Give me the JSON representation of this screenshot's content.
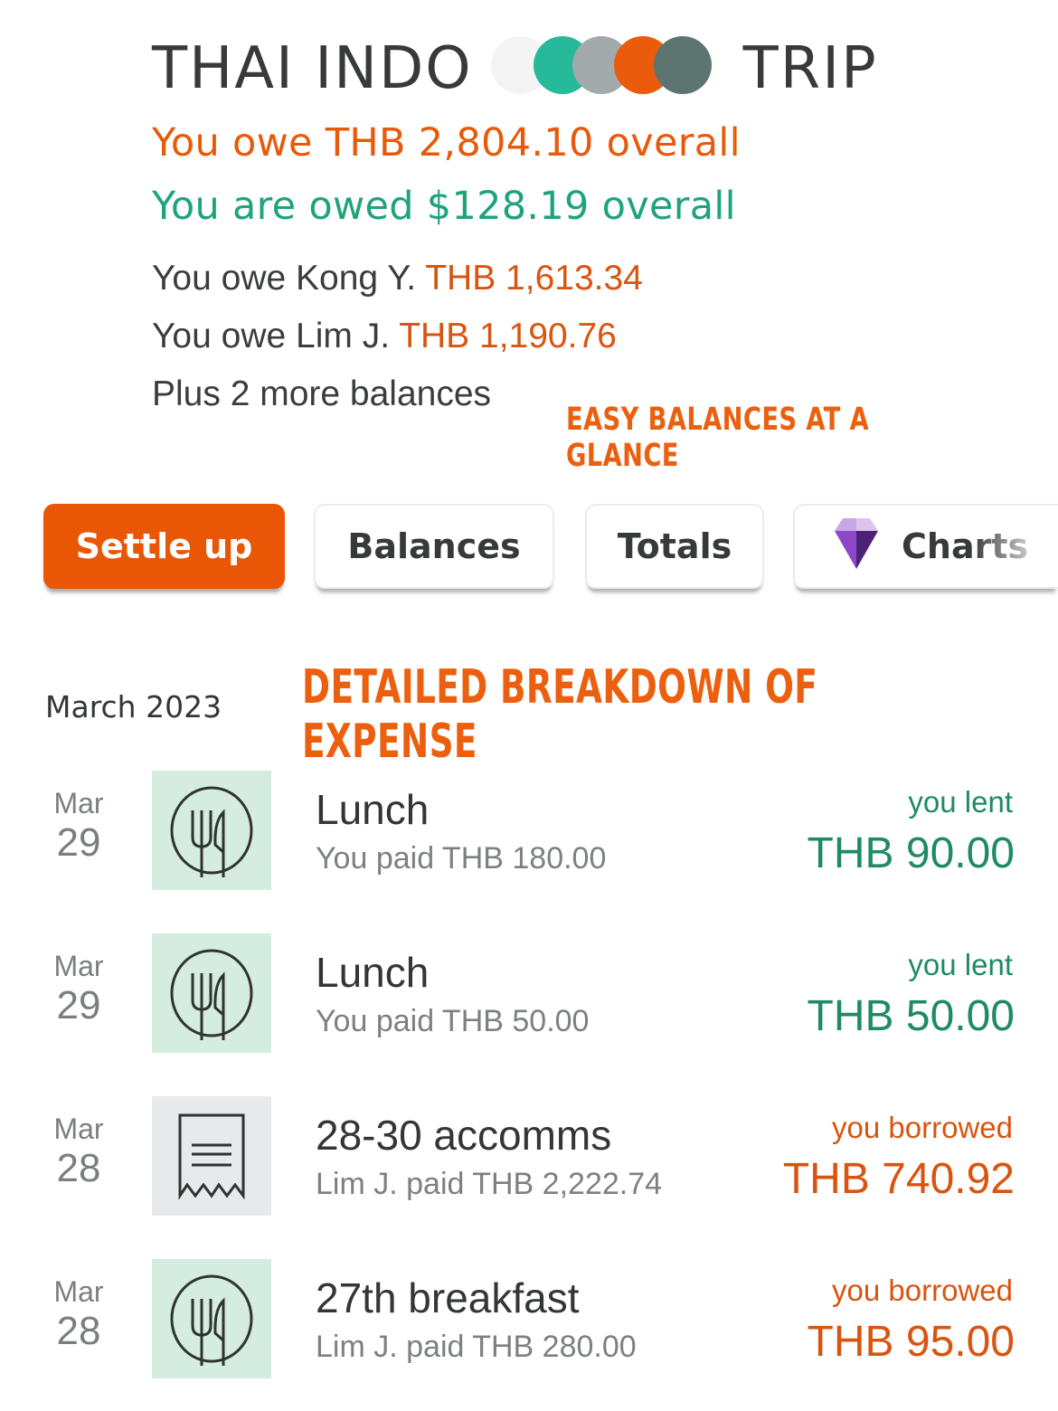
{
  "header": {
    "title_left": "THAI INDO",
    "title_right": "TRIP",
    "avatar_colors": [
      "#f4f4f4",
      "#26b99a",
      "#a3aaab",
      "#ea5b0c",
      "#5d7570"
    ]
  },
  "summary": {
    "owe_overall": "You owe THB 2,804.10 overall",
    "owed_overall": "You are owed $128.19 overall",
    "balances": [
      {
        "prefix": "You owe Kong Y.",
        "amount": "THB 1,613.34"
      },
      {
        "prefix": "You owe Lim J.",
        "amount": "THB 1,190.76"
      }
    ],
    "more_balances": "Plus 2 more balances"
  },
  "annotations": {
    "easy_balances": "EASY BALANCES AT A GLANCE",
    "detailed_breakdown": "DETAILED BREAKDOWN OF EXPENSE"
  },
  "actions": {
    "settle_up": "Settle up",
    "balances": "Balances",
    "totals": "Totals",
    "charts": "Charts",
    "charts_icon": "diamond-icon"
  },
  "colors": {
    "accent_orange": "#e95606",
    "lent_green": "#1e8a68",
    "borrowed_orange": "#d9540f",
    "food_icon_bg": "#d5ece0",
    "receipt_icon_bg": "#e8e9eb"
  },
  "expenses": {
    "month": "March 2023",
    "items": [
      {
        "month": "Mar",
        "day": "29",
        "icon": "fork-knife-plate-icon",
        "title": "Lunch",
        "subtitle": "You paid THB 180.00",
        "label": "you lent",
        "amount": "THB 90.00",
        "type": "lent"
      },
      {
        "month": "Mar",
        "day": "29",
        "icon": "fork-knife-plate-icon",
        "title": "Lunch",
        "subtitle": "You paid THB 50.00",
        "label": "you lent",
        "amount": "THB 50.00",
        "type": "lent"
      },
      {
        "month": "Mar",
        "day": "28",
        "icon": "receipt-icon",
        "title": "28-30 accomms",
        "subtitle": "Lim J. paid THB 2,222.74",
        "label": "you borrowed",
        "amount": "THB 740.92",
        "type": "borrowed"
      },
      {
        "month": "Mar",
        "day": "28",
        "icon": "fork-knife-plate-icon",
        "title": "27th breakfast",
        "subtitle": "Lim J. paid THB 280.00",
        "label": "you borrowed",
        "amount": "THB 95.00",
        "type": "borrowed"
      }
    ]
  }
}
